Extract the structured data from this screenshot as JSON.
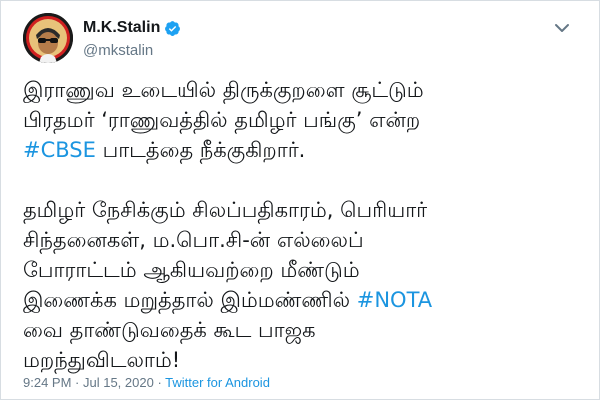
{
  "author": {
    "display_name": "M.K.Stalin",
    "handle": "@mkstalin",
    "verified": true,
    "avatar_icon": "profile-avatar-icon",
    "verified_icon": "verified-badge-icon",
    "menu_icon": "chevron-down-icon"
  },
  "tweet": {
    "paragraph1": {
      "line1": "இராணுவ உடையில் திருக்குறளை சூட்டும்",
      "line2": "பிரதமர் ‘ராணுவத்தில் தமிழர் பங்கு’ என்ற",
      "line3_hashtag": "#CBSE",
      "line3_rest": " பாடத்தை நீக்குகிறார்."
    },
    "paragraph2": {
      "line1": "தமிழர் நேசிக்கும் சிலப்பதிகாரம், பெரியார்",
      "line2": "சிந்தனைகள், ம.பொ.சி-ன் எல்லைப்",
      "line3": "போராட்டம் ஆகியவற்றை மீண்டும்",
      "line4_text": "இணைக்க மறுத்தால் இம்மண்ணில் ",
      "line4_hashtag": "#NOTA",
      "line5": "வை தாண்டுவதைக் கூட பாஜக",
      "line6": "மறந்துவிடலாம்!"
    }
  },
  "meta": {
    "time": "9:24 PM",
    "separator1": " · ",
    "date": "Jul 15, 2020",
    "separator2": " · ",
    "source": "Twitter for Android"
  },
  "colors": {
    "link": "#1b95e0",
    "secondary_text": "#657786",
    "primary_text": "#14171a"
  }
}
